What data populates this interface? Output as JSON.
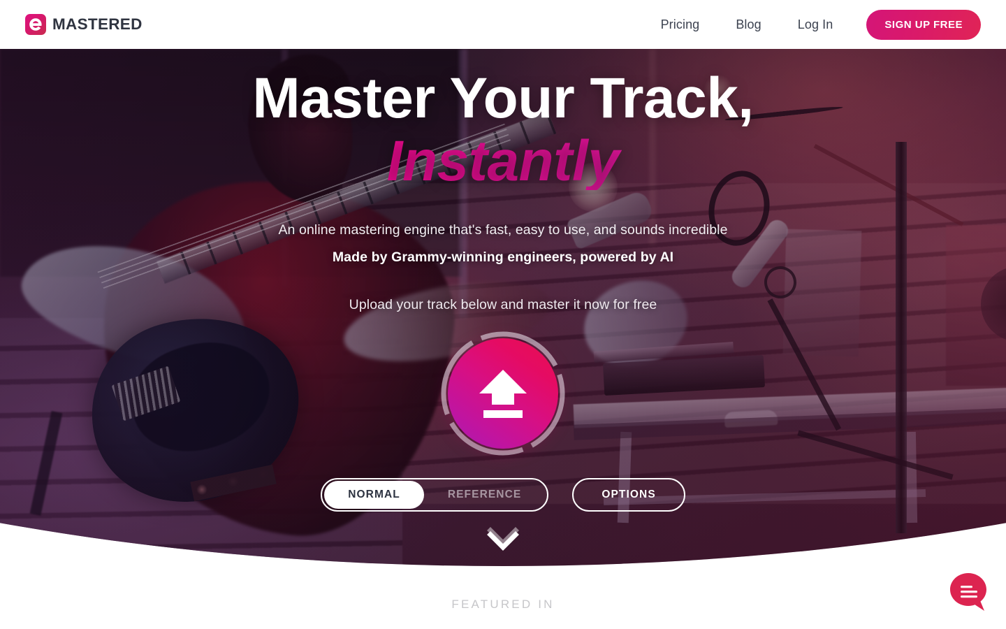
{
  "header": {
    "brand_name": "MASTERED",
    "logo_icon": "emastered-e-logo-icon",
    "nav": [
      {
        "label": "Pricing",
        "name": "nav-link-pricing"
      },
      {
        "label": "Blog",
        "name": "nav-link-blog"
      },
      {
        "label": "Log In",
        "name": "nav-link-login"
      }
    ],
    "cta_label": "SIGN UP FREE"
  },
  "hero": {
    "headline_line1": "Master Your Track,",
    "headline_line2": "Instantly",
    "sub_line1": "An online mastering engine that's fast, easy to use, and sounds incredible",
    "sub_line2": "Made by Grammy-winning engineers, powered by AI",
    "sub_line3": "Upload your track below and master it now for free",
    "upload_icon": "upload-arrow-icon",
    "toggle": {
      "normal_label": "NORMAL",
      "reference_label": "REFERENCE",
      "selected": "NORMAL"
    },
    "options_label": "OPTIONS",
    "scroll_icon": "chevron-down-icon"
  },
  "below_hero": {
    "featured_in_label": "FEATURED IN"
  },
  "chat": {
    "icon": "chat-bubble-icon"
  },
  "colors": {
    "brand_pink": "#d4157a",
    "brand_magenta": "#e8108f",
    "brand_crimson": "#e0234f",
    "chat_red": "#dc2450",
    "nav_text": "#3c4250",
    "featured_text": "#c6c6c9"
  }
}
